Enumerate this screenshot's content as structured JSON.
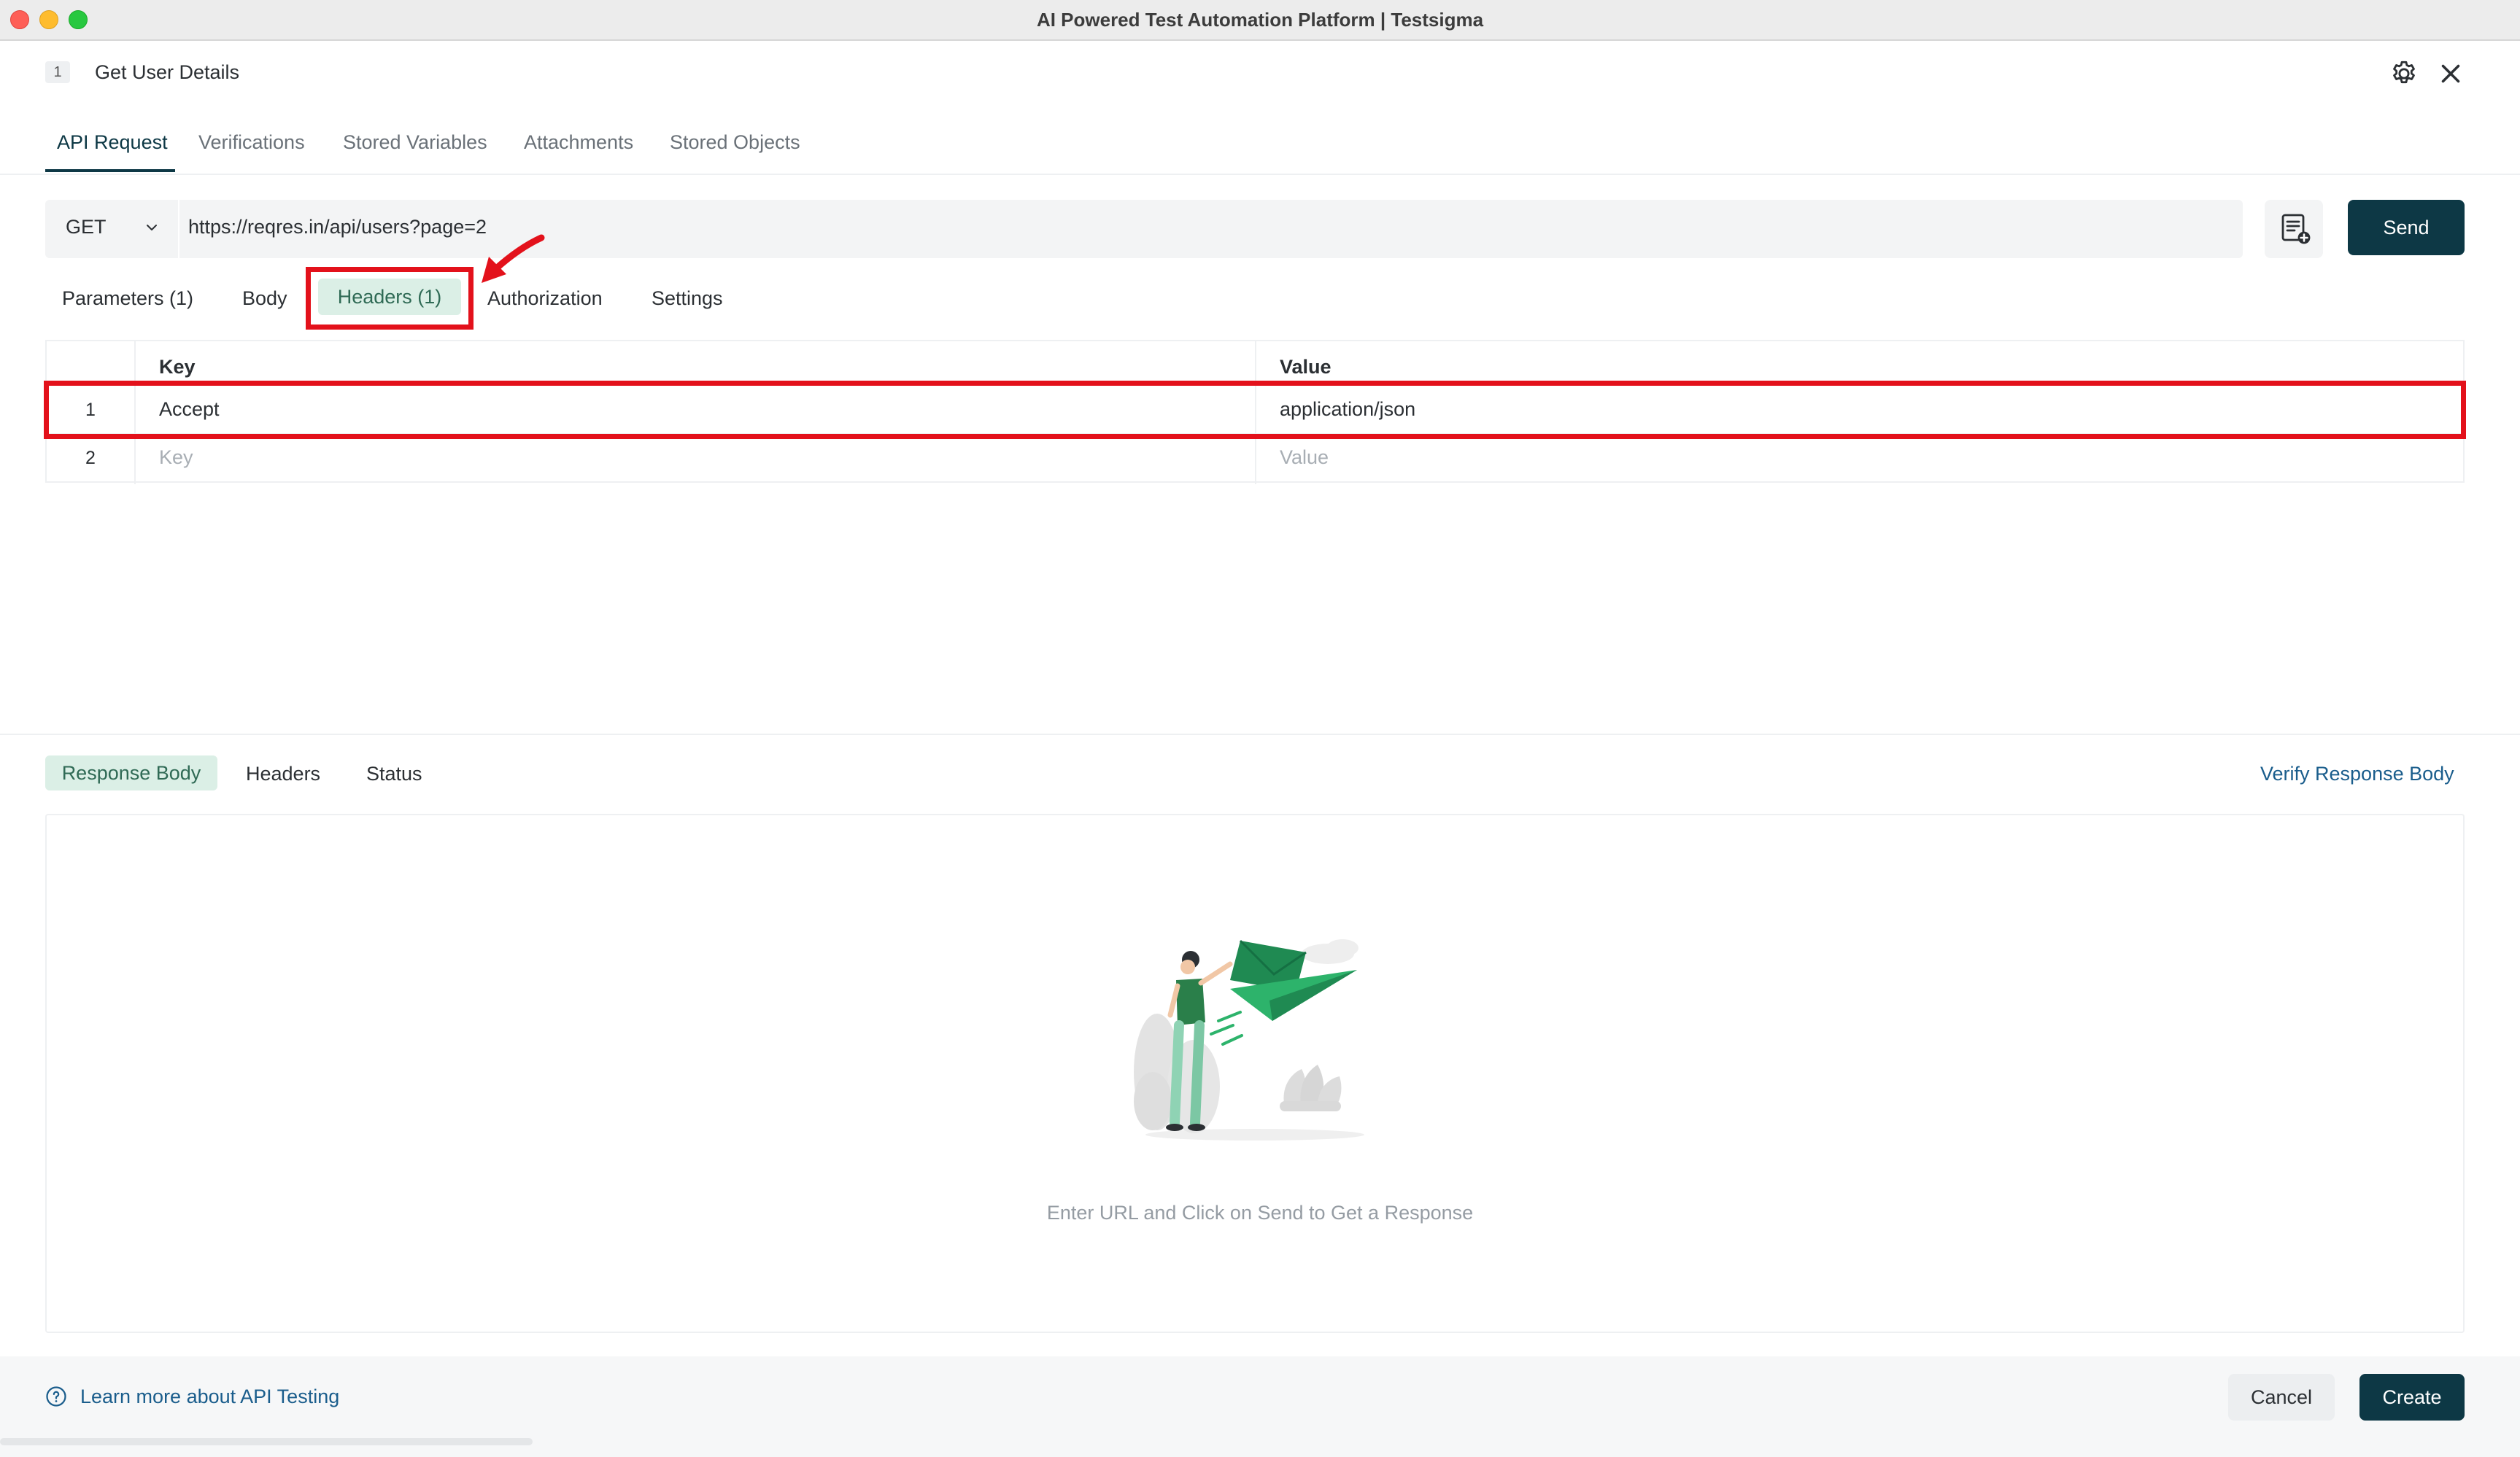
{
  "window": {
    "title": "AI Powered Test Automation Platform | Testsigma"
  },
  "header": {
    "step_number": "1",
    "step_title": "Get User Details"
  },
  "main_tabs": [
    {
      "label": "API Request",
      "active": true
    },
    {
      "label": "Verifications"
    },
    {
      "label": "Stored Variables"
    },
    {
      "label": "Attachments"
    },
    {
      "label": "Stored Objects"
    }
  ],
  "request": {
    "method": "GET",
    "url": "https://reqres.in/api/users?page=2",
    "send_label": "Send"
  },
  "request_tabs": [
    {
      "label": "Parameters (1)"
    },
    {
      "label": "Body"
    },
    {
      "label": "Headers (1)",
      "active": true
    },
    {
      "label": "Authorization"
    },
    {
      "label": "Settings"
    }
  ],
  "headers_table": {
    "columns": [
      "Key",
      "Value"
    ],
    "rows": [
      {
        "num": "1",
        "key": "Accept",
        "value": "application/json"
      },
      {
        "num": "2",
        "key_placeholder": "Key",
        "value_placeholder": "Value"
      }
    ]
  },
  "response": {
    "tabs": [
      {
        "label": "Response Body",
        "active": true
      },
      {
        "label": "Headers"
      },
      {
        "label": "Status"
      }
    ],
    "verify_link": "Verify Response Body",
    "empty_message": "Enter URL and Click on Send to Get a Response"
  },
  "footer": {
    "learn_link": "Learn more about API Testing",
    "cancel_label": "Cancel",
    "create_label": "Create"
  },
  "colors": {
    "primary": "#0d3845",
    "active_tab_bg": "#dbefe6",
    "highlight": "#e3111b",
    "link": "#1a5d8c"
  }
}
